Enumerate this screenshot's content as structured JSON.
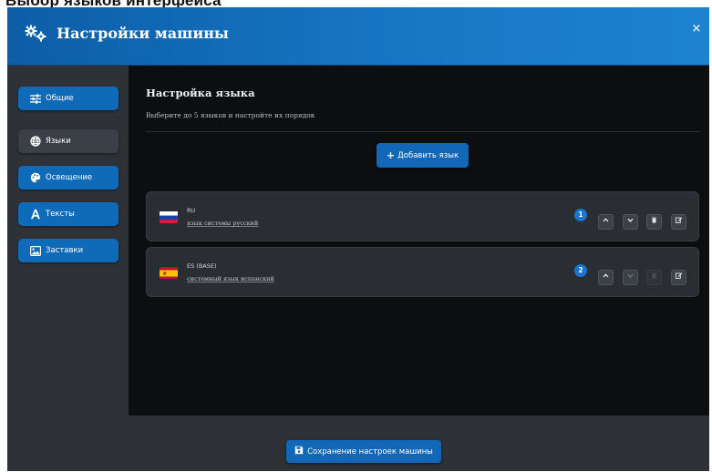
{
  "page": {
    "caption": "Выбор языков интерфейса"
  },
  "modal": {
    "title": "Настройки машины",
    "title_icon": "gears-icon",
    "close_label": "×"
  },
  "sidebar": {
    "items": [
      {
        "label": "Общие",
        "icon": "sliders-icon",
        "active": false
      },
      {
        "label": "Языки",
        "icon": "globe-icon",
        "active": true
      },
      {
        "label": "Освещение",
        "icon": "palette-icon",
        "active": false
      },
      {
        "label": "Тексты",
        "icon": "font-icon",
        "active": false
      },
      {
        "label": "Заставки",
        "icon": "image-icon",
        "active": false
      }
    ]
  },
  "content": {
    "title": "Настройка языка",
    "subtitle": "Выберите до 5 языков и настройте их порядок",
    "add_button": {
      "plus": "+",
      "label": "Добавить язык"
    }
  },
  "languages": [
    {
      "code": "RU",
      "name": "язык системы русский",
      "order": "1",
      "flag": "ru",
      "actions": {
        "up_enabled": true,
        "down_enabled": true,
        "delete_enabled": true,
        "edit_enabled": true
      }
    },
    {
      "code": "ES (BASE)",
      "name": "системный язык испанский",
      "order": "2",
      "flag": "es",
      "actions": {
        "up_enabled": true,
        "down_enabled": true,
        "delete_enabled": false,
        "edit_enabled": true
      }
    }
  ],
  "footer": {
    "save_label": "Сохранение настроек машины",
    "save_icon": "floppy-icon"
  },
  "colors": {
    "accent": "#1267b6",
    "header_gradient_start": "#0c5ea6",
    "header_gradient_end": "#1d82d0",
    "modal_bg": "#121417",
    "panel_bg": "#2e3136",
    "card_bg": "#2a2d32",
    "badge": "#1876d0"
  }
}
